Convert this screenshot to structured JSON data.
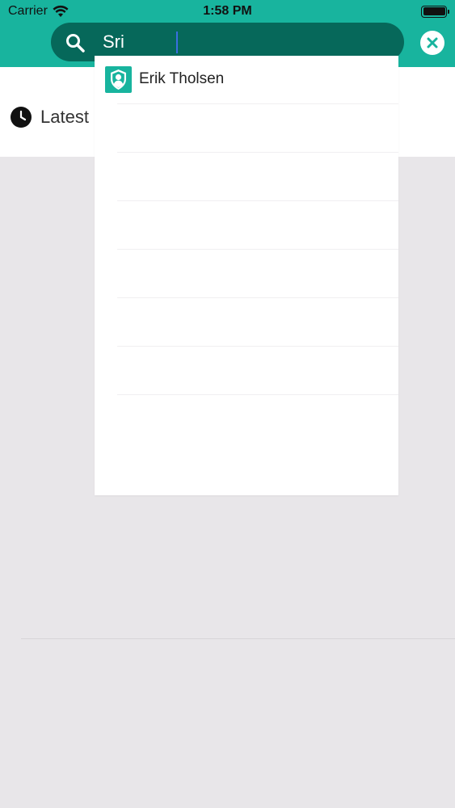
{
  "status_bar": {
    "carrier": "Carrier",
    "time": "1:58 PM"
  },
  "search": {
    "value": "Sri",
    "icon": "search-icon",
    "clear_icon": "close-circle-icon"
  },
  "latest": {
    "label": "Latest",
    "icon": "clock-icon"
  },
  "suggestions": {
    "items": [
      {
        "name": "Erik Tholsen",
        "icon": "user-shield-icon"
      },
      {
        "name": ""
      },
      {
        "name": ""
      },
      {
        "name": ""
      },
      {
        "name": ""
      },
      {
        "name": ""
      },
      {
        "name": ""
      },
      {
        "name": ""
      }
    ]
  },
  "colors": {
    "header": "#18b49e",
    "search_pill": "#06685a",
    "background": "#e8e6e9"
  }
}
